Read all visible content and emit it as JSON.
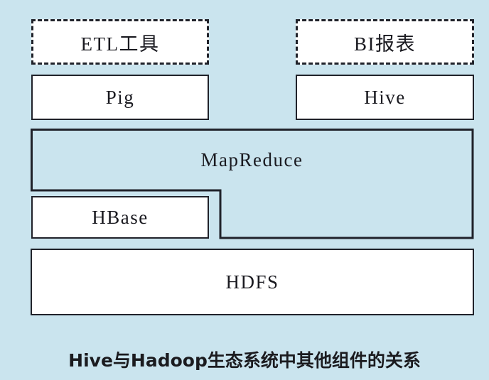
{
  "page": {
    "background_color": "#cae4ee",
    "stroke_color": "#20222a",
    "fill_color": "#ffffff",
    "text_color": "#1a1a20"
  },
  "diagram": {
    "caption": "Hive与Hadoop生态系统中其他组件的关系",
    "nodes": [
      {
        "id": "etl",
        "label": "ETL工具",
        "border": "dashed",
        "fill": "white"
      },
      {
        "id": "bi",
        "label": "BI报表",
        "border": "dashed",
        "fill": "white"
      },
      {
        "id": "pig",
        "label": "Pig",
        "border": "solid",
        "fill": "white"
      },
      {
        "id": "hive",
        "label": "Hive",
        "border": "solid",
        "fill": "white"
      },
      {
        "id": "mapreduce",
        "label": "MapReduce",
        "border": "solid",
        "fill": "transparent"
      },
      {
        "id": "hbase",
        "label": "HBase",
        "border": "solid",
        "fill": "white"
      },
      {
        "id": "hdfs",
        "label": "HDFS",
        "border": "solid",
        "fill": "white"
      }
    ]
  }
}
